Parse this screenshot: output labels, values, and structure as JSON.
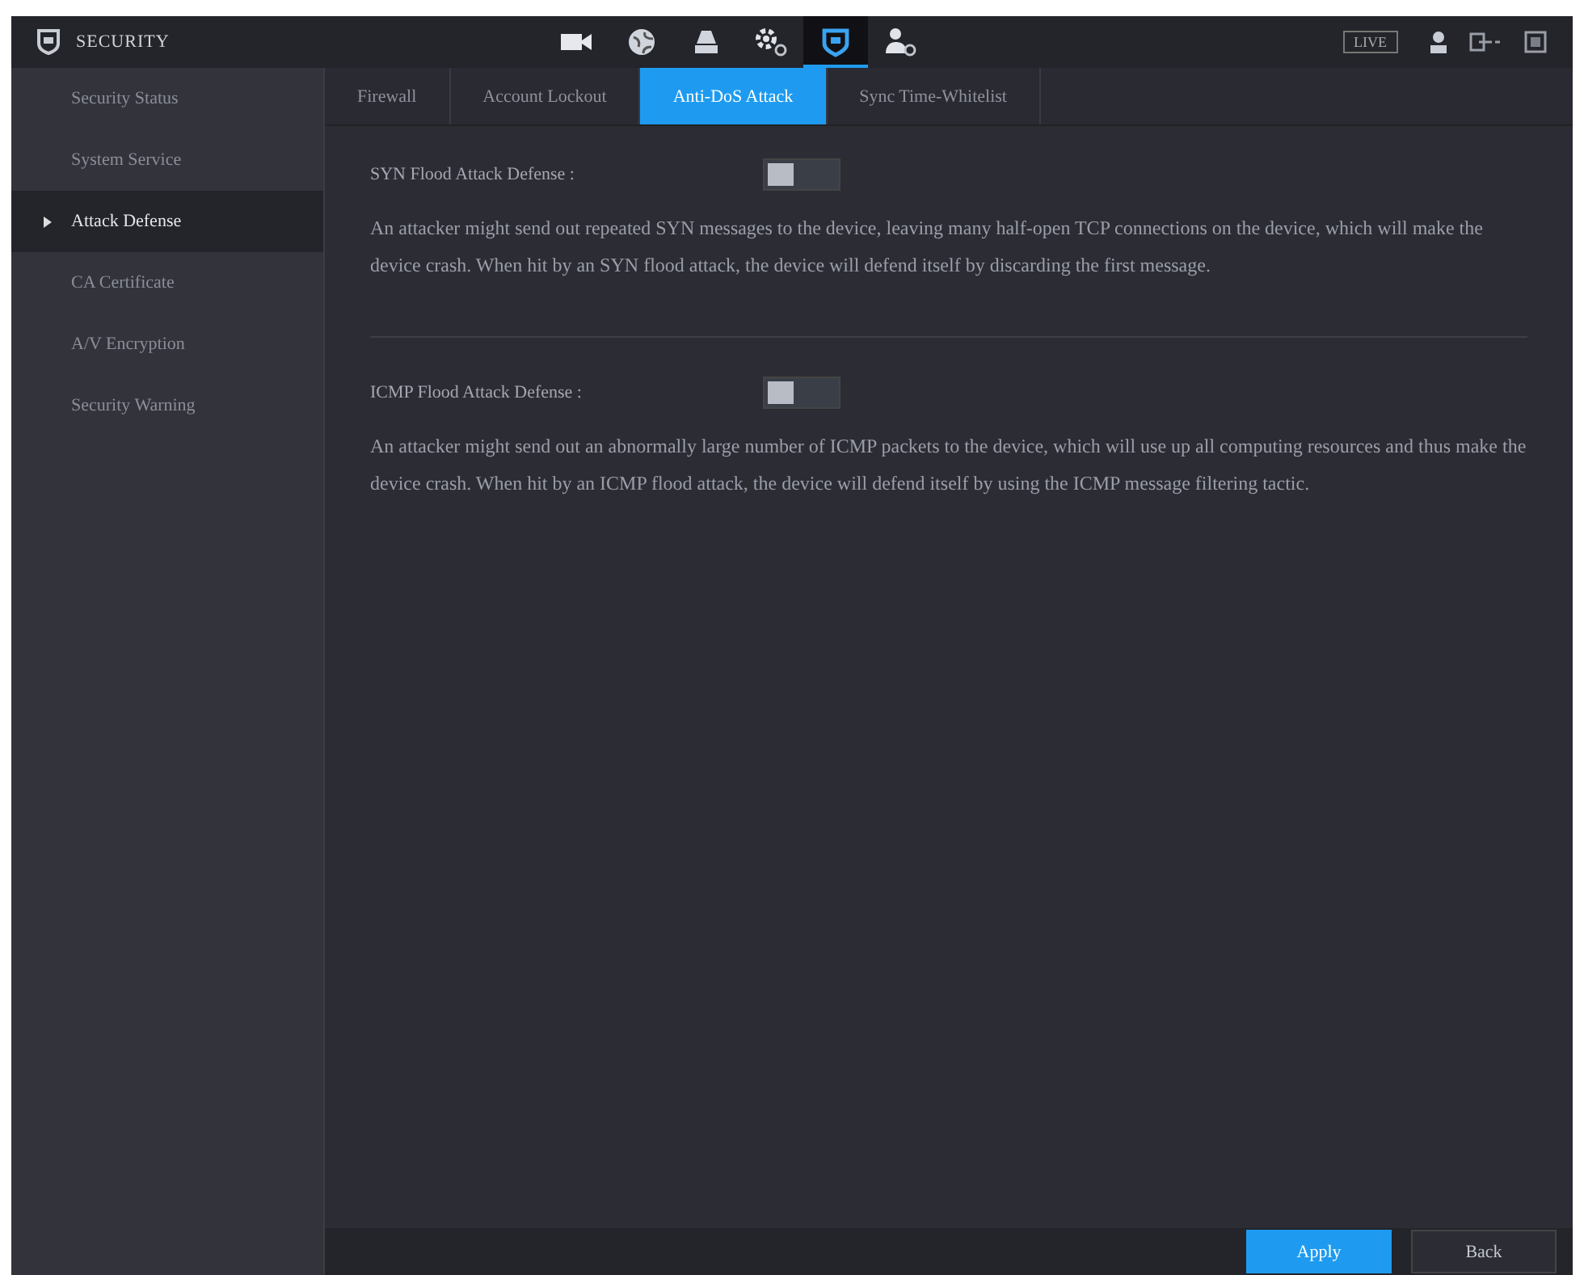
{
  "header": {
    "title": "SECURITY",
    "icons": [
      {
        "kind": "camera",
        "selected": false
      },
      {
        "kind": "network",
        "selected": false
      },
      {
        "kind": "storage",
        "selected": false
      },
      {
        "kind": "system",
        "selected": false
      },
      {
        "kind": "security",
        "selected": true
      },
      {
        "kind": "account",
        "selected": false
      }
    ],
    "live_label": "LIVE"
  },
  "sidebar": {
    "items": [
      {
        "label": "Security Status",
        "selected": false
      },
      {
        "label": "System Service",
        "selected": false
      },
      {
        "label": "Attack Defense",
        "selected": true
      },
      {
        "label": "CA Certificate",
        "selected": false
      },
      {
        "label": "A/V Encryption",
        "selected": false
      },
      {
        "label": "Security Warning",
        "selected": false
      }
    ]
  },
  "tabs": [
    {
      "label": "Firewall",
      "selected": false
    },
    {
      "label": "Account Lockout",
      "selected": false
    },
    {
      "label": "Anti-DoS Attack",
      "selected": true
    },
    {
      "label": "Sync Time-Whitelist",
      "selected": false
    }
  ],
  "sections": [
    {
      "label": "SYN Flood Attack Defense :",
      "on": false,
      "description": "An attacker might send out repeated SYN messages to the device, leaving many half-open TCP connections on the device, which will make the device crash. When hit by an SYN flood attack, the device will defend itself by discarding the first message."
    },
    {
      "label": "ICMP Flood Attack Defense :",
      "on": false,
      "description": "An attacker might send out an abnormally large number of ICMP packets to the device, which will use up all computing resources and thus make the device crash. When hit by an ICMP flood attack, the device will defend itself by using the ICMP message filtering tactic."
    }
  ],
  "buttons": [
    {
      "label": "Apply",
      "kind": "primary"
    },
    {
      "label": "Back",
      "kind": "secondary"
    }
  ]
}
